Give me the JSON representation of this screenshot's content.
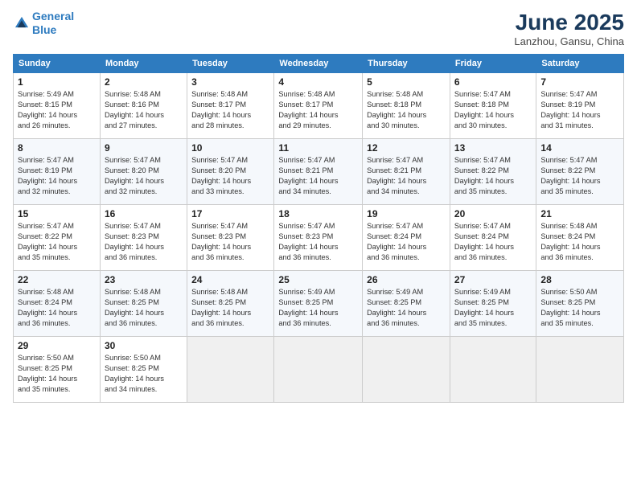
{
  "header": {
    "logo_line1": "General",
    "logo_line2": "Blue",
    "month": "June 2025",
    "location": "Lanzhou, Gansu, China"
  },
  "weekdays": [
    "Sunday",
    "Monday",
    "Tuesday",
    "Wednesday",
    "Thursday",
    "Friday",
    "Saturday"
  ],
  "weeks": [
    [
      {
        "day": "1",
        "info": "Sunrise: 5:49 AM\nSunset: 8:15 PM\nDaylight: 14 hours\nand 26 minutes."
      },
      {
        "day": "2",
        "info": "Sunrise: 5:48 AM\nSunset: 8:16 PM\nDaylight: 14 hours\nand 27 minutes."
      },
      {
        "day": "3",
        "info": "Sunrise: 5:48 AM\nSunset: 8:17 PM\nDaylight: 14 hours\nand 28 minutes."
      },
      {
        "day": "4",
        "info": "Sunrise: 5:48 AM\nSunset: 8:17 PM\nDaylight: 14 hours\nand 29 minutes."
      },
      {
        "day": "5",
        "info": "Sunrise: 5:48 AM\nSunset: 8:18 PM\nDaylight: 14 hours\nand 30 minutes."
      },
      {
        "day": "6",
        "info": "Sunrise: 5:47 AM\nSunset: 8:18 PM\nDaylight: 14 hours\nand 30 minutes."
      },
      {
        "day": "7",
        "info": "Sunrise: 5:47 AM\nSunset: 8:19 PM\nDaylight: 14 hours\nand 31 minutes."
      }
    ],
    [
      {
        "day": "8",
        "info": "Sunrise: 5:47 AM\nSunset: 8:19 PM\nDaylight: 14 hours\nand 32 minutes."
      },
      {
        "day": "9",
        "info": "Sunrise: 5:47 AM\nSunset: 8:20 PM\nDaylight: 14 hours\nand 32 minutes."
      },
      {
        "day": "10",
        "info": "Sunrise: 5:47 AM\nSunset: 8:20 PM\nDaylight: 14 hours\nand 33 minutes."
      },
      {
        "day": "11",
        "info": "Sunrise: 5:47 AM\nSunset: 8:21 PM\nDaylight: 14 hours\nand 34 minutes."
      },
      {
        "day": "12",
        "info": "Sunrise: 5:47 AM\nSunset: 8:21 PM\nDaylight: 14 hours\nand 34 minutes."
      },
      {
        "day": "13",
        "info": "Sunrise: 5:47 AM\nSunset: 8:22 PM\nDaylight: 14 hours\nand 35 minutes."
      },
      {
        "day": "14",
        "info": "Sunrise: 5:47 AM\nSunset: 8:22 PM\nDaylight: 14 hours\nand 35 minutes."
      }
    ],
    [
      {
        "day": "15",
        "info": "Sunrise: 5:47 AM\nSunset: 8:22 PM\nDaylight: 14 hours\nand 35 minutes."
      },
      {
        "day": "16",
        "info": "Sunrise: 5:47 AM\nSunset: 8:23 PM\nDaylight: 14 hours\nand 36 minutes."
      },
      {
        "day": "17",
        "info": "Sunrise: 5:47 AM\nSunset: 8:23 PM\nDaylight: 14 hours\nand 36 minutes."
      },
      {
        "day": "18",
        "info": "Sunrise: 5:47 AM\nSunset: 8:23 PM\nDaylight: 14 hours\nand 36 minutes."
      },
      {
        "day": "19",
        "info": "Sunrise: 5:47 AM\nSunset: 8:24 PM\nDaylight: 14 hours\nand 36 minutes."
      },
      {
        "day": "20",
        "info": "Sunrise: 5:47 AM\nSunset: 8:24 PM\nDaylight: 14 hours\nand 36 minutes."
      },
      {
        "day": "21",
        "info": "Sunrise: 5:48 AM\nSunset: 8:24 PM\nDaylight: 14 hours\nand 36 minutes."
      }
    ],
    [
      {
        "day": "22",
        "info": "Sunrise: 5:48 AM\nSunset: 8:24 PM\nDaylight: 14 hours\nand 36 minutes."
      },
      {
        "day": "23",
        "info": "Sunrise: 5:48 AM\nSunset: 8:25 PM\nDaylight: 14 hours\nand 36 minutes."
      },
      {
        "day": "24",
        "info": "Sunrise: 5:48 AM\nSunset: 8:25 PM\nDaylight: 14 hours\nand 36 minutes."
      },
      {
        "day": "25",
        "info": "Sunrise: 5:49 AM\nSunset: 8:25 PM\nDaylight: 14 hours\nand 36 minutes."
      },
      {
        "day": "26",
        "info": "Sunrise: 5:49 AM\nSunset: 8:25 PM\nDaylight: 14 hours\nand 36 minutes."
      },
      {
        "day": "27",
        "info": "Sunrise: 5:49 AM\nSunset: 8:25 PM\nDaylight: 14 hours\nand 35 minutes."
      },
      {
        "day": "28",
        "info": "Sunrise: 5:50 AM\nSunset: 8:25 PM\nDaylight: 14 hours\nand 35 minutes."
      }
    ],
    [
      {
        "day": "29",
        "info": "Sunrise: 5:50 AM\nSunset: 8:25 PM\nDaylight: 14 hours\nand 35 minutes."
      },
      {
        "day": "30",
        "info": "Sunrise: 5:50 AM\nSunset: 8:25 PM\nDaylight: 14 hours\nand 34 minutes."
      },
      {
        "day": "",
        "info": ""
      },
      {
        "day": "",
        "info": ""
      },
      {
        "day": "",
        "info": ""
      },
      {
        "day": "",
        "info": ""
      },
      {
        "day": "",
        "info": ""
      }
    ]
  ]
}
